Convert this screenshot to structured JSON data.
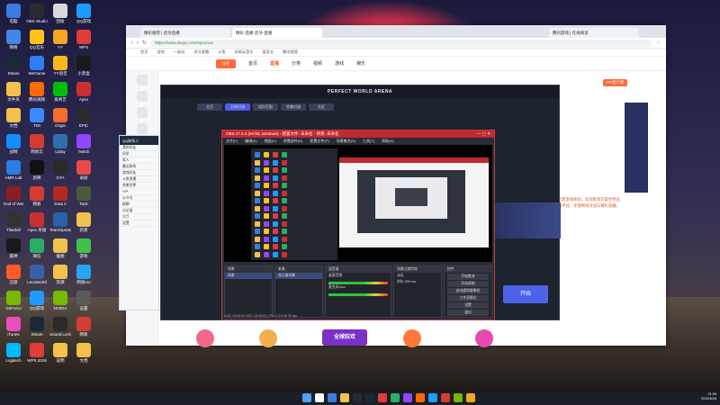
{
  "desktop": {
    "icons": [
      {
        "label": "电脑",
        "c": "#3b7be0"
      },
      {
        "label": "OBS Studio",
        "c": "#2a2a33"
      },
      {
        "label": "回收",
        "c": "#d9d9d9"
      },
      {
        "label": "QQ游戏",
        "c": "#1e9bff"
      },
      {
        "label": "网络",
        "c": "#3f86e6"
      },
      {
        "label": "QQ音乐",
        "c": "#ffc31a"
      },
      {
        "label": "YY",
        "c": "#f5a623"
      },
      {
        "label": "WPS",
        "c": "#e03c3c"
      },
      {
        "label": "Steam",
        "c": "#1b2838"
      },
      {
        "label": "WeGame",
        "c": "#2d7ff9"
      },
      {
        "label": "YY语音",
        "c": "#f9b71e"
      },
      {
        "label": "小黑盒",
        "c": "#1a1a1a"
      },
      {
        "label": "文件夹",
        "c": "#f2c14e"
      },
      {
        "label": "腾讯视频",
        "c": "#ff6a00"
      },
      {
        "label": "爱奇艺",
        "c": "#00be06"
      },
      {
        "label": "Apex",
        "c": "#c93131"
      },
      {
        "label": "文档",
        "c": "#f2c14e"
      },
      {
        "label": "TIM",
        "c": "#3a89ff"
      },
      {
        "label": "Origin",
        "c": "#f56c2d"
      },
      {
        "label": "EPIC",
        "c": "#2b2b2b"
      },
      {
        "label": "战网",
        "c": "#148eff"
      },
      {
        "label": "网易云",
        "c": "#d43c33"
      },
      {
        "label": "Uplay",
        "c": "#2f6fb0"
      },
      {
        "label": "Twitch",
        "c": "#9146ff"
      },
      {
        "label": "AMR Lab",
        "c": "#2a7de1"
      },
      {
        "label": "剪映",
        "c": "#111111"
      },
      {
        "label": "GTA",
        "c": "#2a2a2a"
      },
      {
        "label": "录屏",
        "c": "#e84a4a"
      },
      {
        "label": "God of War",
        "c": "#8a1f1f"
      },
      {
        "label": "网易",
        "c": "#d43c33"
      },
      {
        "label": "Dota 2",
        "c": "#b02a20"
      },
      {
        "label": "Tank",
        "c": "#4a5a3a"
      },
      {
        "label": "Titanfall",
        "c": "#333333"
      },
      {
        "label": "Apex 英雄",
        "c": "#c93131"
      },
      {
        "label": "TeamSpeak",
        "c": "#2962a8"
      },
      {
        "label": "新建",
        "c": "#f2c14e"
      },
      {
        "label": "雷神",
        "c": "#1a1a1a"
      },
      {
        "label": "微信",
        "c": "#2aae67"
      },
      {
        "label": "截图",
        "c": "#f2c14e"
      },
      {
        "label": "游戏",
        "c": "#3dc24a"
      },
      {
        "label": "迅游",
        "c": "#ff5a2a"
      },
      {
        "label": "LeonWorld",
        "c": "#3b5ea8"
      },
      {
        "label": "资源",
        "c": "#f2c14e"
      },
      {
        "label": "网易UU",
        "c": "#2aa3f0"
      },
      {
        "label": "GeForce",
        "c": "#76b900"
      },
      {
        "label": "QQ游戏",
        "c": "#1e9bff"
      },
      {
        "label": "NVIDIA",
        "c": "#76b900"
      },
      {
        "label": "设置",
        "c": "#5a5a5a"
      },
      {
        "label": "iTunes",
        "c": "#ea4cc0"
      },
      {
        "label": "Steam",
        "c": "#1b2838"
      },
      {
        "label": "Sound Lock",
        "c": "#2a2a2a"
      },
      {
        "label": "网易",
        "c": "#d43c33"
      },
      {
        "label": "Logitech",
        "c": "#00b8fc"
      },
      {
        "label": "WPS 2019",
        "c": "#e03c3c"
      },
      {
        "label": "说明",
        "c": "#f2c14e"
      },
      {
        "label": "文档",
        "c": "#f2c14e"
      }
    ]
  },
  "browser": {
    "tabs": [
      "精彩推荐 | 虎牙直播",
      "精彩-直播 虎牙-直播"
    ],
    "right_tab": "腾讯游戏 | 在线阅读",
    "url": "https://www.douyu.com/topic/xxx",
    "bookmarks": [
      "首页",
      "游戏",
      "一起玩",
      "虎牙直播",
      "斗鱼",
      "网易云音乐",
      "爱奇艺",
      "腾讯视频"
    ],
    "site_nav": {
      "logo": "斗鱼",
      "items": [
        "首页",
        "直播",
        "分类",
        "视频",
        "游戏",
        "娱乐"
      ],
      "active_index": 1
    },
    "right_panel": {
      "badge": "PC客户端",
      "text": "全新游戏体验，欢迎来到完美世界竞技平台，享受畅快对战与精彩直播。"
    }
  },
  "game_window": {
    "title": "PERFECT WORLD ARENA",
    "tabs": [
      "主页",
      "天梯对战",
      "组队匹配",
      "完美对战",
      "社区"
    ],
    "active_tab": 1,
    "start_label": "开始"
  },
  "qq": {
    "header": "QQ联系人",
    "rows": [
      "我的好友",
      "同学",
      "家人",
      "最近联系",
      "游戏好友",
      "斗鱼直播",
      "完美世界",
      "VIP",
      "公众号",
      "群聊",
      "讨论组",
      "大厅",
      "设置"
    ]
  },
  "obs": {
    "title": "OBS 27.2.3 (64-bit, windows) - 配置文件: 未命名 - 场景: 未命名",
    "menu": [
      "文件(F)",
      "编辑(E)",
      "视图(V)",
      "停靠部件(D)",
      "配置文件(P)",
      "场景集合(S)",
      "工具(T)",
      "帮助(H)"
    ],
    "docks": [
      {
        "title": "场景",
        "items": [
          "场景"
        ]
      },
      {
        "title": "来源",
        "items": [
          "显示器采集"
        ]
      },
      {
        "title": "混音器",
        "items": [
          "桌面音频",
          "麦克风/Aux"
        ]
      },
      {
        "title": "场景过渡特效",
        "items": [
          "淡出",
          "时长 300 ms"
        ]
      },
      {
        "title": "控件",
        "items": [
          "开始推流",
          "开始录制",
          "启动虚拟摄像机",
          "工作室模式",
          "设置",
          "退出"
        ]
      }
    ],
    "status": "LIVE: 00:00:00   REC: 00:00:00   CPU: 1.2%   60.00 fps"
  },
  "bottom": {
    "title": "全球狂欢"
  },
  "taskbar": {
    "time": "21:05",
    "date": "2022/8/28"
  }
}
